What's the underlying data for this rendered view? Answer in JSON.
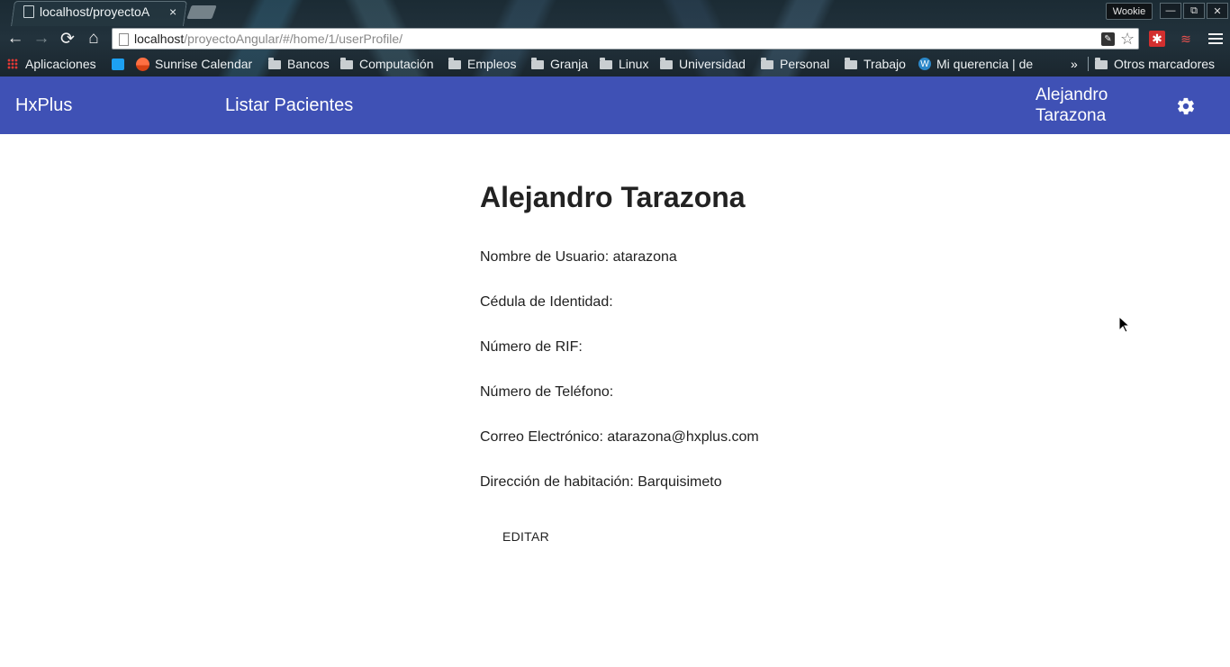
{
  "browser": {
    "tab_title": "localhost/proyectoA",
    "tab_close": "×",
    "profile_name": "Wookie",
    "url_host": "localhost",
    "url_path": "/proyectoAngular/#/home/1/userProfile/",
    "window_buttons": {
      "minimize": "—",
      "restore": "⧉",
      "close": "✕"
    },
    "nav": {
      "back": "←",
      "forward": "→",
      "reload": "⟳",
      "home": "⌂"
    },
    "bookmarks": {
      "apps": "Aplicaciones",
      "sunrise": "Sunrise Calendar",
      "bancos": "Bancos",
      "computacion": "Computación",
      "empleos": "Empleos",
      "granja": "Granja",
      "linux": "Linux",
      "universidad": "Universidad",
      "personal": "Personal",
      "trabajo": "Trabajo",
      "mi_querencia": "Mi querencia | de",
      "overflow": "»",
      "otros": "Otros marcadores"
    }
  },
  "header": {
    "brand": "HxPlus",
    "nav_link": "Listar Pacientes",
    "user_first": "Alejandro",
    "user_last": "Tarazona"
  },
  "profile": {
    "title": "Alejandro Tarazona",
    "fields": [
      {
        "label": "Nombre de Usuario:",
        "value": "atarazona"
      },
      {
        "label": "Cédula de Identidad:",
        "value": ""
      },
      {
        "label": "Número de RIF:",
        "value": ""
      },
      {
        "label": "Número de Teléfono:",
        "value": ""
      },
      {
        "label": "Correo Electrónico:",
        "value": "atarazona@hxplus.com"
      },
      {
        "label": "Dirección de habitación:",
        "value": "Barquisimeto"
      }
    ],
    "edit_label": "EDITAR"
  },
  "colors": {
    "header_bg": "#3f51b5",
    "header_text": "#ffffff"
  }
}
